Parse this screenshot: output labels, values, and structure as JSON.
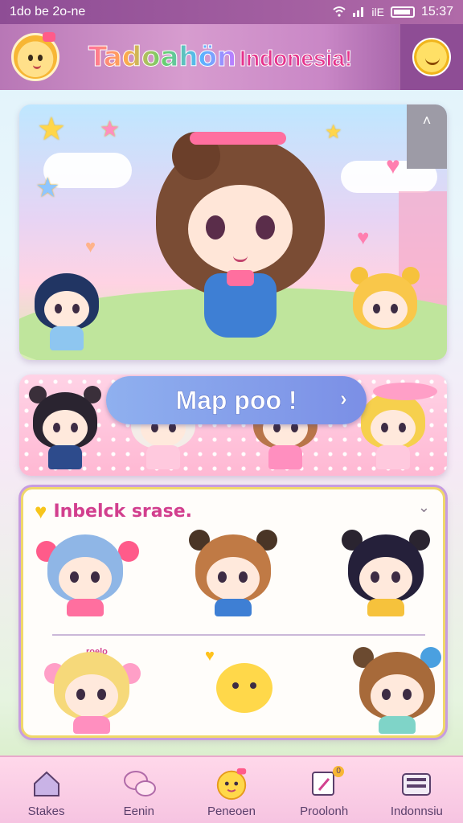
{
  "status_bar": {
    "left": "1do be 2o-ne",
    "time": "15:37",
    "network": "ilE"
  },
  "header": {
    "title_main": "Tadoahön",
    "title_sub": "Indonesia!"
  },
  "hero": {
    "scroll_hint": "˄"
  },
  "map_banner": {
    "button_label": "Map poo !"
  },
  "unlock_panel": {
    "title": "Inbelck srase.",
    "caption": "roelo"
  },
  "bottom_nav": [
    {
      "label": "Stakes",
      "icon": "home-icon"
    },
    {
      "label": "Eenin",
      "icon": "chat-bubble-icon"
    },
    {
      "label": "Peneoen",
      "icon": "mascot-icon"
    },
    {
      "label": "Proolonh",
      "icon": "card-icon",
      "badge": "0"
    },
    {
      "label": "Indonnsiu",
      "icon": "keyboard-icon"
    }
  ],
  "colors": {
    "accent": "#8e4d95",
    "pink": "#e6338c",
    "button": "#7b8fe6",
    "panel_border": "#f0d86a"
  }
}
